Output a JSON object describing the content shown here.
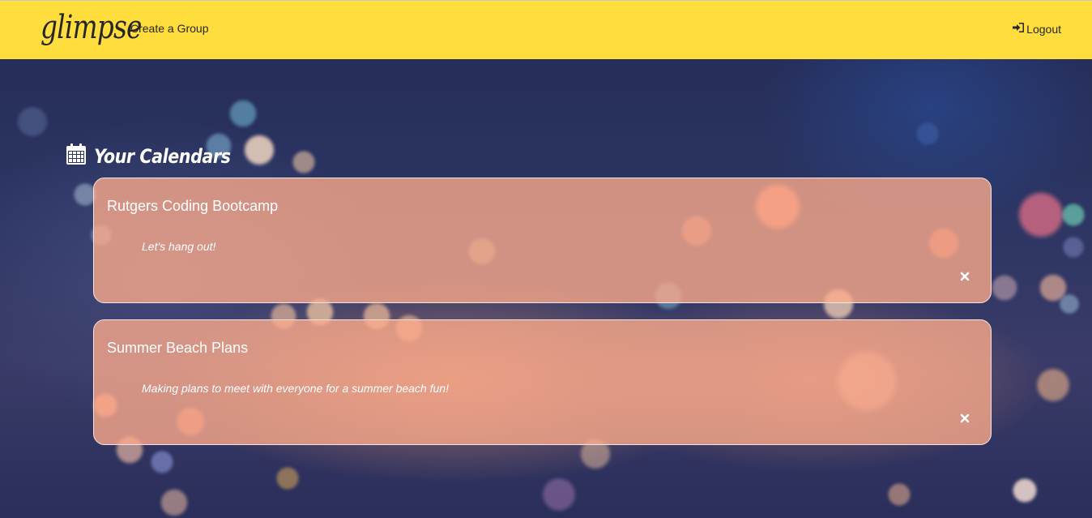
{
  "app": {
    "logo": "glimpse"
  },
  "navbar": {
    "create_group_label": "Create a Group",
    "logout_label": "Logout",
    "background_color": "#ffdd3c"
  },
  "section": {
    "title": "Your Calendars",
    "icon": "calendar-icon"
  },
  "calendars": [
    {
      "title": "Rutgers Coding Bootcamp",
      "description": "Let's hang out!",
      "delete_icon": "close-icon"
    },
    {
      "title": "Summer Beach Plans",
      "description": "Making plans to meet with everyone for a summer beach fun!",
      "delete_icon": "close-icon"
    }
  ]
}
